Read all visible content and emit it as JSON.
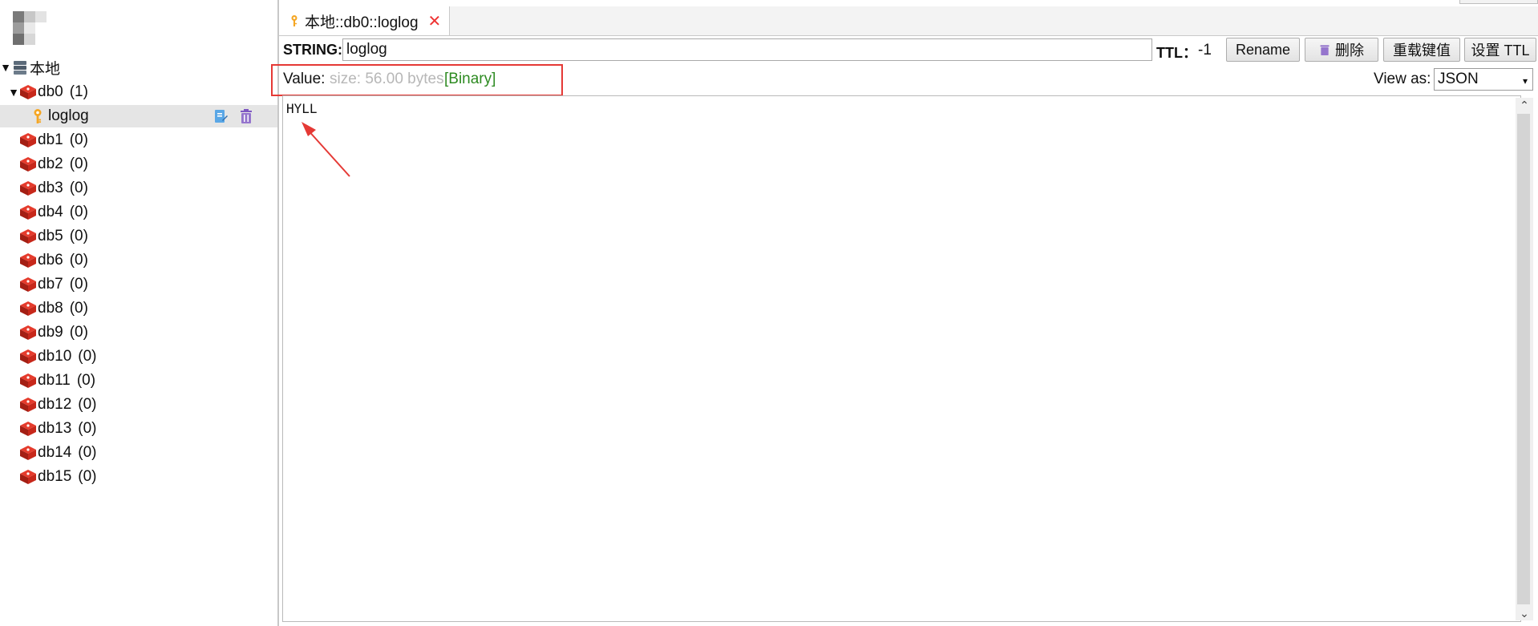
{
  "tree": {
    "root": {
      "label": "本地"
    },
    "db0": {
      "label": "db0",
      "count": "(1)"
    },
    "key_item": {
      "label": "loglog"
    },
    "dbs": [
      {
        "label": "db1",
        "count": "(0)"
      },
      {
        "label": "db2",
        "count": "(0)"
      },
      {
        "label": "db3",
        "count": "(0)"
      },
      {
        "label": "db4",
        "count": "(0)"
      },
      {
        "label": "db5",
        "count": "(0)"
      },
      {
        "label": "db6",
        "count": "(0)"
      },
      {
        "label": "db7",
        "count": "(0)"
      },
      {
        "label": "db8",
        "count": "(0)"
      },
      {
        "label": "db9",
        "count": "(0)"
      },
      {
        "label": "db10",
        "count": "(0)"
      },
      {
        "label": "db11",
        "count": "(0)"
      },
      {
        "label": "db12",
        "count": "(0)"
      },
      {
        "label": "db13",
        "count": "(0)"
      },
      {
        "label": "db14",
        "count": "(0)"
      },
      {
        "label": "db15",
        "count": "(0)"
      }
    ]
  },
  "tab": {
    "title": "本地::db0::loglog",
    "close": "✕"
  },
  "key_bar": {
    "type_label": "STRING:",
    "key_value": "loglog",
    "ttl_label": "TTL：",
    "ttl_value": "-1",
    "rename": "Rename",
    "delete": "删除",
    "reload": "重载键值",
    "set_ttl": "设置 TTL"
  },
  "value_bar": {
    "label": "Value:",
    "size": "size: 56.00 bytes",
    "binary": "[Binary]",
    "view_as_label": "View as:",
    "view_as_value": "JSON"
  },
  "editor": {
    "content": "HYLL"
  },
  "colors": {
    "accent_red": "#e53935",
    "binary_green": "#2e8b22",
    "size_grey": "#b7b7b7",
    "selection": "#e5e5e5"
  },
  "icons": {
    "root": "server-stack-icon",
    "db": "redis-cube-icon",
    "key": "key-icon",
    "edit": "edit-key-icon",
    "trash": "trash-icon",
    "dropdown": "chevron-down-icon",
    "annotation": "red-arrow-icon"
  }
}
